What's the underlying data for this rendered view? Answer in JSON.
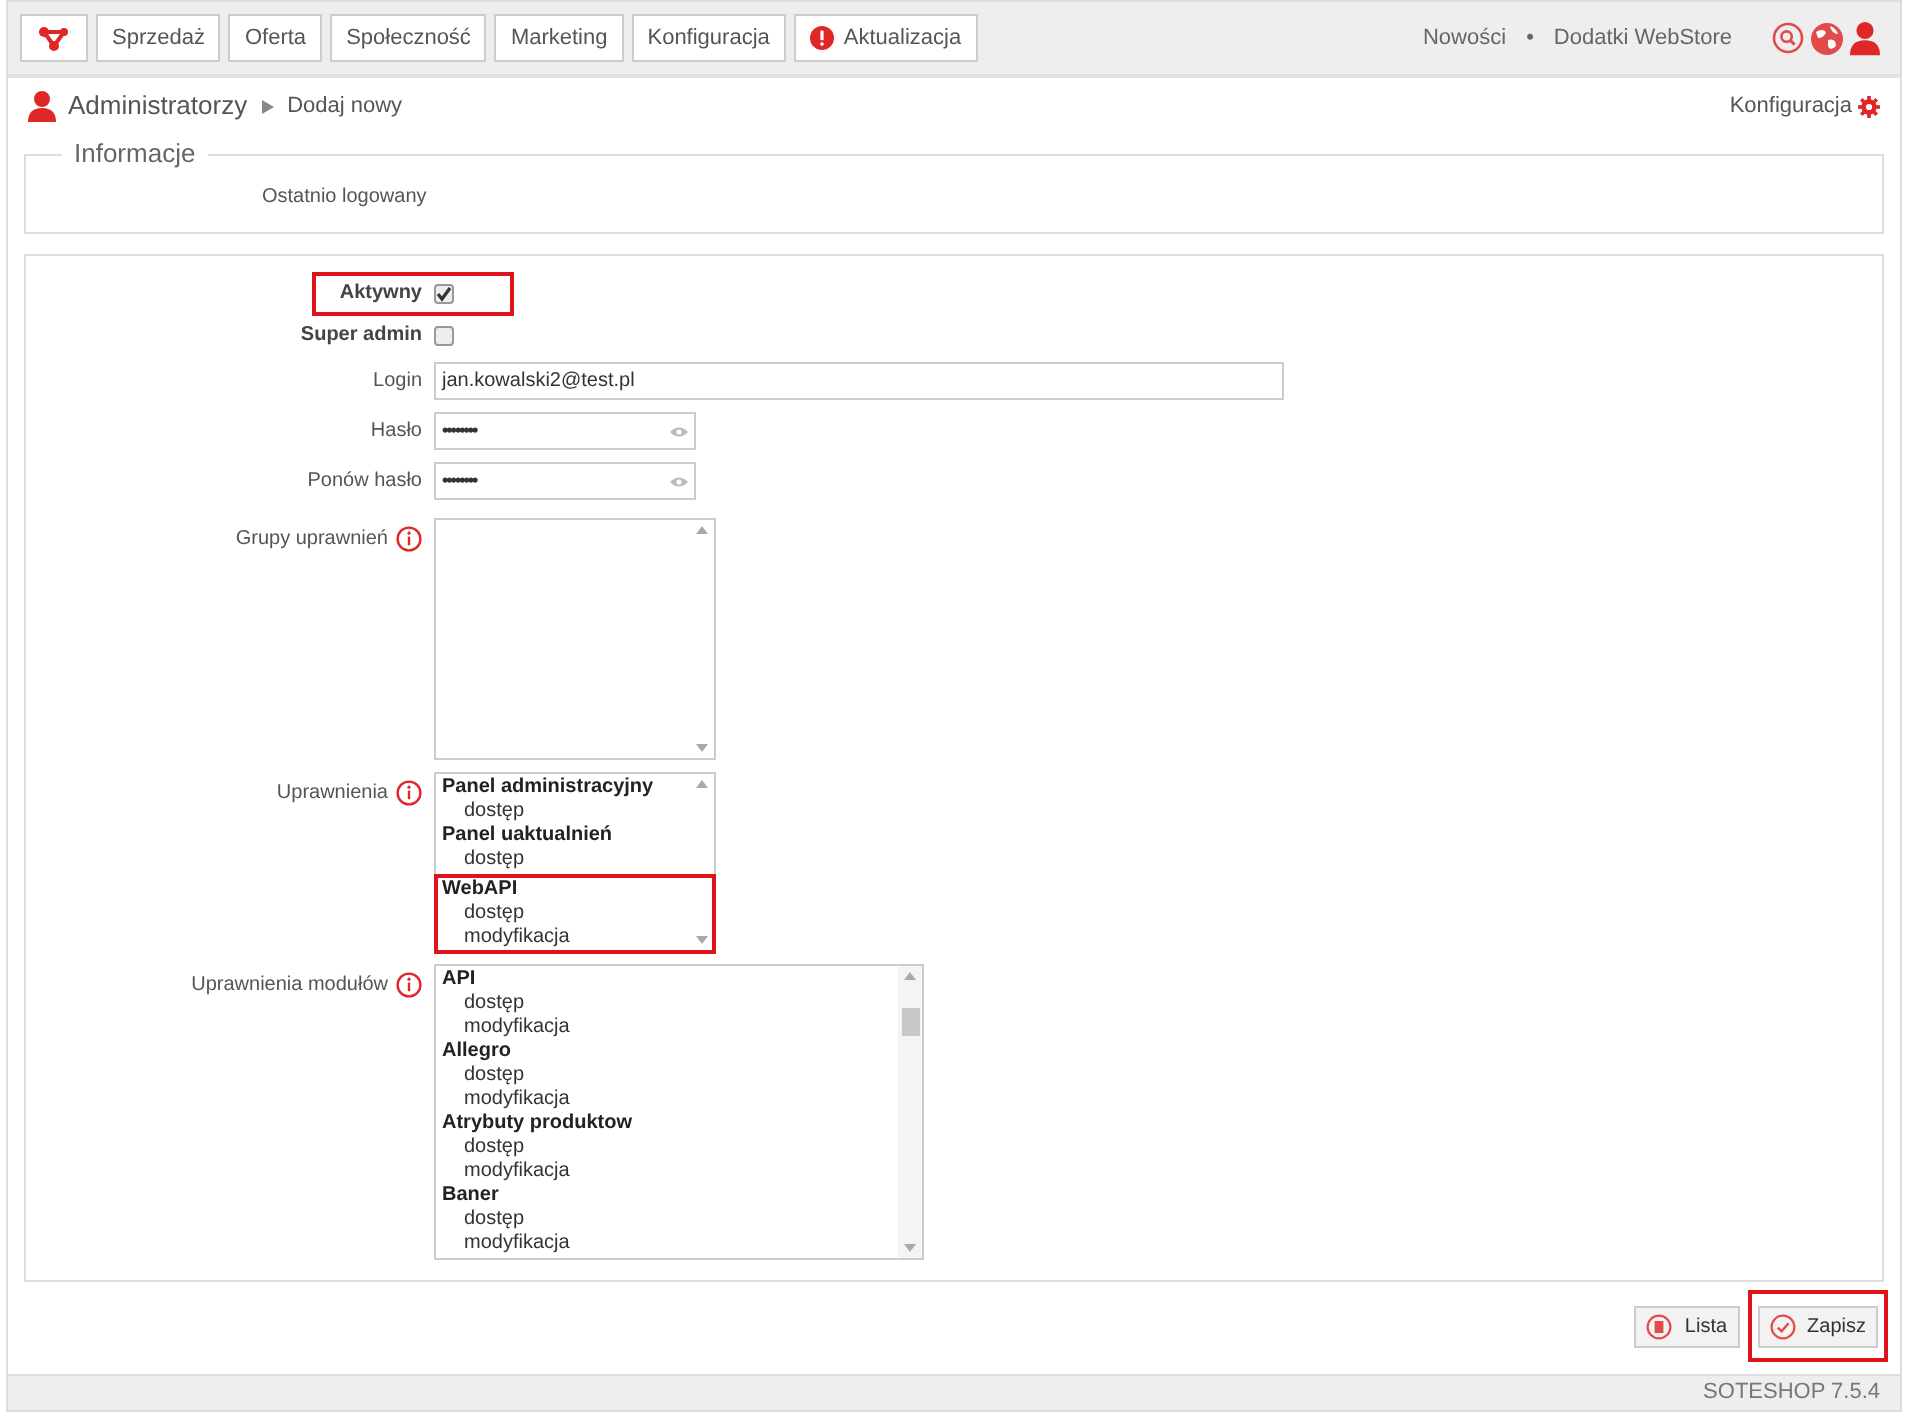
{
  "top_nav": {
    "tabs": [
      {
        "label": "Sprzedaż"
      },
      {
        "label": "Oferta"
      },
      {
        "label": "Społeczność"
      },
      {
        "label": "Marketing"
      },
      {
        "label": "Konfiguracja"
      },
      {
        "label": "Aktualizacja",
        "alert": true
      }
    ],
    "links": [
      {
        "label": "Nowości"
      },
      {
        "label": "Dodatki WebStore"
      }
    ],
    "separator": "•"
  },
  "breadcrumb": {
    "items": [
      "Administratorzy",
      "Dodaj nowy"
    ],
    "settings_link": "Konfiguracja"
  },
  "info_section": {
    "legend": "Informacje",
    "fields": [
      {
        "label": "Ostatnio logowany"
      }
    ]
  },
  "form": {
    "fields": [
      {
        "kind": "checkbox",
        "label": "Aktywny",
        "checked": true,
        "highlighted": true
      },
      {
        "kind": "checkbox",
        "label": "Super admin",
        "checked": false,
        "highlighted": false
      },
      {
        "kind": "text",
        "label": "Login",
        "value": "jan.kowalski2@test.pl"
      },
      {
        "kind": "password",
        "label": "Hasło",
        "value": "••••••••"
      },
      {
        "kind": "password",
        "label": "Ponów hasło",
        "value": "••••••••"
      },
      {
        "kind": "listbox",
        "label": "Grupy uprawnień",
        "info": true
      },
      {
        "kind": "listbox",
        "label": "Uprawnienia",
        "info": true,
        "groups": [
          {
            "title": "Panel administracyjny",
            "options": [
              "dostęp"
            ],
            "highlighted": false
          },
          {
            "title": "Panel uaktualnień",
            "options": [
              "dostęp"
            ],
            "highlighted": false
          },
          {
            "title": "WebAPI",
            "options": [
              "dostęp",
              "modyfikacja"
            ],
            "highlighted": true
          }
        ]
      },
      {
        "kind": "listbox",
        "label": "Uprawnienia modułów",
        "info": true,
        "groups": [
          {
            "title": "API",
            "options": [
              "dostęp",
              "modyfikacja"
            ],
            "highlighted": false
          },
          {
            "title": "Allegro",
            "options": [
              "dostęp",
              "modyfikacja"
            ],
            "highlighted": false
          },
          {
            "title": "Atrybuty produktow",
            "options": [
              "dostęp",
              "modyfikacja"
            ],
            "highlighted": false
          },
          {
            "title": "Baner",
            "options": [
              "dostęp",
              "modyfikacja"
            ],
            "highlighted": false
          }
        ]
      }
    ]
  },
  "actions": [
    {
      "kind": "list",
      "label": "Lista",
      "highlighted": false
    },
    {
      "kind": "save",
      "label": "Zapisz",
      "highlighted": true
    }
  ],
  "footer": "SOTESHOP 7.5.4"
}
